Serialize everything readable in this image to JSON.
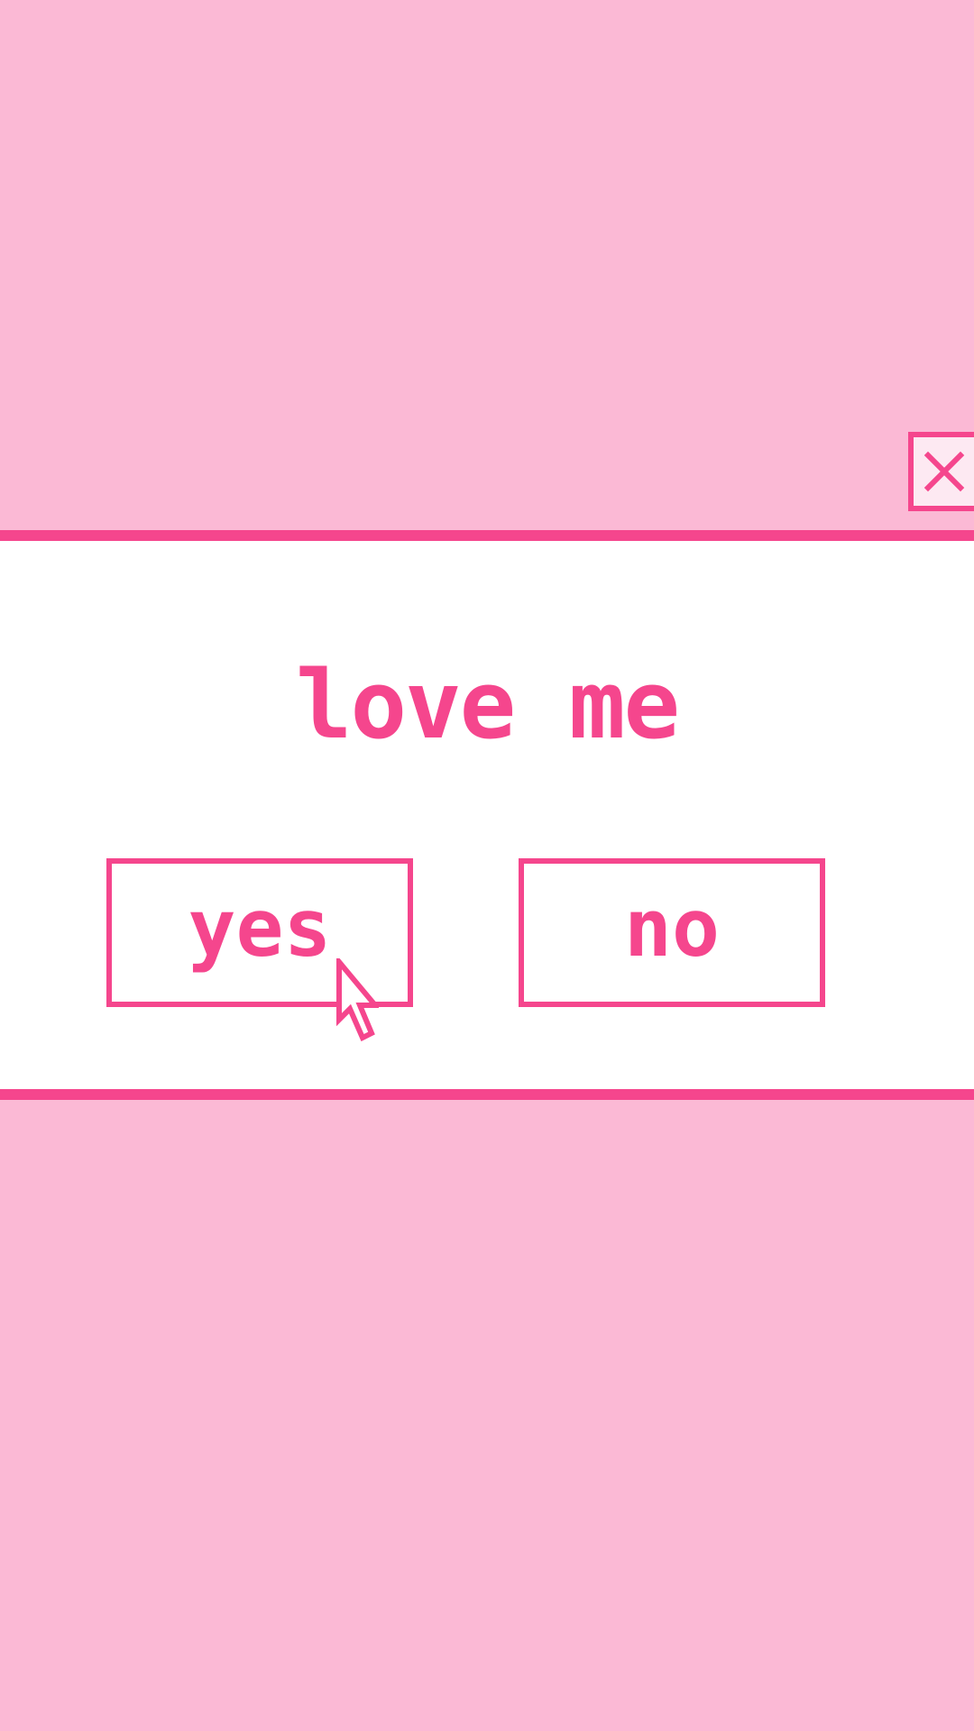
{
  "dialog": {
    "title": "love me",
    "yes_label": "yes",
    "no_label": "no"
  },
  "icons": {
    "close": "close-icon",
    "cursor": "mouse-pointer-icon"
  },
  "colors": {
    "background": "#fbb9d5",
    "accent": "#f5468d",
    "dialog_background": "#ffffff",
    "close_button_background": "#fde9f2"
  }
}
